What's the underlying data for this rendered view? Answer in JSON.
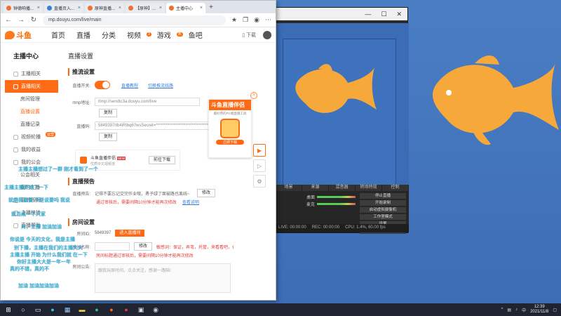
{
  "browser": {
    "tabs": [
      {
        "label": "钟德响播...",
        "active": false
      },
      {
        "label": "直播页入...",
        "active": false
      },
      {
        "label": "原神直播...",
        "active": false
      },
      {
        "label": "【原神】...",
        "active": false
      },
      {
        "label": "主播中心",
        "active": true
      }
    ],
    "url": "mp.douyu.com/live/main"
  },
  "site": {
    "logo_text": "斗鱼",
    "nav": [
      "首页",
      "直播",
      "分类",
      "视频",
      "游戏",
      "鱼吧"
    ],
    "nav_badges": {
      "视频": "3",
      "游戏": "热"
    },
    "header_right": [
      "下载"
    ]
  },
  "sidebar": {
    "title": "主播中心",
    "items": [
      {
        "label": "主播相关",
        "type": "group"
      },
      {
        "label": "直播相关",
        "type": "active"
      },
      {
        "label": "房间管理",
        "type": "sub"
      },
      {
        "label": "直播设置",
        "type": "subactive"
      },
      {
        "label": "直播记录",
        "type": "sub"
      },
      {
        "label": "视频轮播",
        "type": "group",
        "tag": "运营"
      },
      {
        "label": "我的收益",
        "type": "group"
      },
      {
        "label": "我的公会",
        "type": "group"
      },
      {
        "label": "公会相关",
        "type": "sub"
      },
      {
        "label": "我的主播",
        "type": "sub"
      },
      {
        "label": "我的视频",
        "type": "group"
      },
      {
        "label": "主播扶持",
        "type": "group"
      },
      {
        "label": "直播帮助",
        "type": "group"
      }
    ]
  },
  "main": {
    "page_title": "直播设置",
    "stream": {
      "heading": "推流设置",
      "switch_label": "直播开关:",
      "switch_on": true,
      "link_tutorial": "直播教程",
      "link_reset": "切换推流线路",
      "rtmp_label": "rtmp地址:",
      "rtmp_value": "rtmp://sendtc3a.douyu.com/live",
      "copy_label": "复制",
      "code_label": "直播码:",
      "code_value": "5849397rtb4iRlbq6?wsSecret=**********************************",
      "copy_label2": "复制"
    },
    "promo": {
      "title": "斗鱼直播伴侣",
      "tag": "NEW",
      "desc": "优质中文视频流",
      "action": "前往下载"
    },
    "preview": {
      "heading": "直播预告",
      "label": "直播预告:",
      "value": "记得不要忘记交完作业哦，勇子绿了面被路也离线~",
      "edit": "修改",
      "status_red": "通过审核后，需要间隔10分钟才能再次修改",
      "link": "查看说明"
    },
    "room": {
      "heading": "房间设置",
      "id_label": "房间ID:",
      "id_value": "5849397",
      "id_button": "进入直播间",
      "name_label": "房间名称:",
      "edit": "修改",
      "warn": "敏感词：保证，弄弯，托管，来看看吧，省钱中",
      "warn2": "房间标题通过审核后，需要间隔10分钟才能再次修改",
      "notice_label": "房间公告:",
      "notice_placeholder": "跟我玩原时间，点点关注，感谢一路陪!"
    }
  },
  "float_ad": {
    "title": "斗鱼直播伴侣",
    "sub": "最好用的PC端直播工具",
    "button": "立即下载",
    "close": "×"
  },
  "overlay_texts": [
    "主播主播想过了一群 刚才看到了一个",
    "主播主播开始了一下",
    "就是我说要 不是说要吗 我说",
    "就当成一下大家",
    "对，主播 加油加油",
    "你说是 今天的文化，我是主播",
    "别下播，主播在我们的主播大大",
    "主播主播 开始 为什么我们就 在一下",
    "你好主播大大是一年一年",
    "真的不错，真的不",
    "加油 加油加油加油"
  ],
  "obs": {
    "panel_heads": [
      "场景",
      "来源",
      "混音器",
      "转场特效",
      "控制"
    ],
    "mixer": [
      {
        "name": "桌面",
        "level": 0.6
      },
      {
        "name": "麦克",
        "level": 0.45
      }
    ],
    "controls": [
      "停止直播",
      "开始录制",
      "启动虚拟摄像机",
      "工作室模式",
      "设置",
      "退出"
    ],
    "status": [
      "LIVE: 00:00:00",
      "REC: 00:00:00",
      "CPU: 1.4%, 60.00 fps"
    ]
  },
  "taskbar": {
    "time": "12:39",
    "date": "2021/11/8"
  },
  "colors": {
    "accent": "#ff6a14",
    "desktop": "#3f6fb8",
    "fish": "#f6a93a",
    "overlay_text": "#27c0e8"
  }
}
